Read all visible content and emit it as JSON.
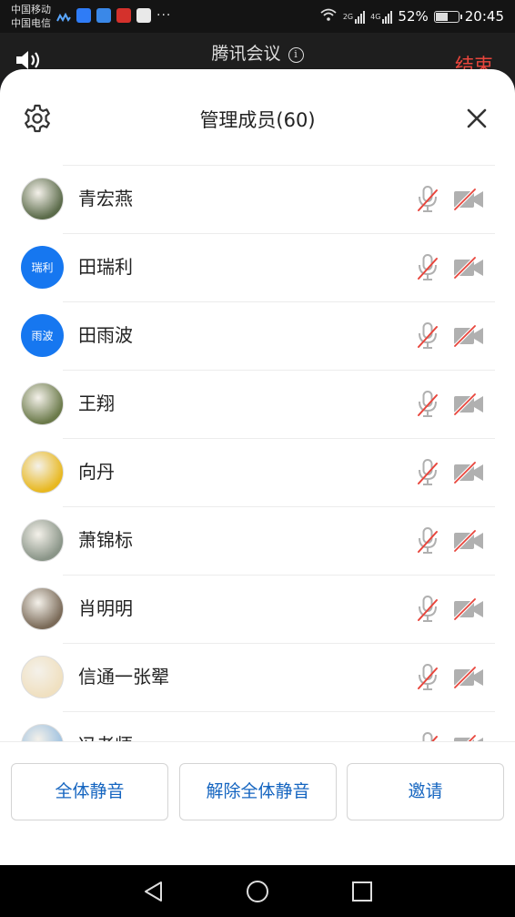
{
  "status_bar": {
    "carrier1": "中国移动",
    "carrier2": "中国电信",
    "net1": "2G",
    "net2": "4G",
    "battery": "52%",
    "battery_level": 0.52,
    "time": "20:45",
    "more": "···"
  },
  "meeting": {
    "title": "腾讯会议",
    "info": "i",
    "end_label": "结束"
  },
  "sheet": {
    "title": "管理成员(60)"
  },
  "members": [
    {
      "name": "青宏燕",
      "avatar_text": "",
      "avatar_color": "#5b6b4a"
    },
    {
      "name": "田瑞利",
      "avatar_text": "瑞利",
      "avatar_color": "#1677f0"
    },
    {
      "name": "田雨波",
      "avatar_text": "雨波",
      "avatar_color": "#1677f0"
    },
    {
      "name": "王翔",
      "avatar_text": "",
      "avatar_color": "#6b7a4a"
    },
    {
      "name": "向丹",
      "avatar_text": "",
      "avatar_color": "#e8b820"
    },
    {
      "name": "萧锦标",
      "avatar_text": "",
      "avatar_color": "#8a9588"
    },
    {
      "name": "肖明明",
      "avatar_text": "",
      "avatar_color": "#7a6a58"
    },
    {
      "name": "信通一张翚",
      "avatar_text": "",
      "avatar_color": "#f0e0c0"
    },
    {
      "name": "冯老师",
      "avatar_text": "",
      "avatar_color": "#9cc0e0"
    }
  ],
  "actions": {
    "mute_all": "全体静音",
    "unmute_all": "解除全体静音",
    "invite": "邀请"
  },
  "colors": {
    "accent": "#1565c0",
    "danger": "#e8453c",
    "avatar_blue": "#1677f0",
    "muted_icon": "#b0b0b0",
    "strike": "#e8453c"
  }
}
